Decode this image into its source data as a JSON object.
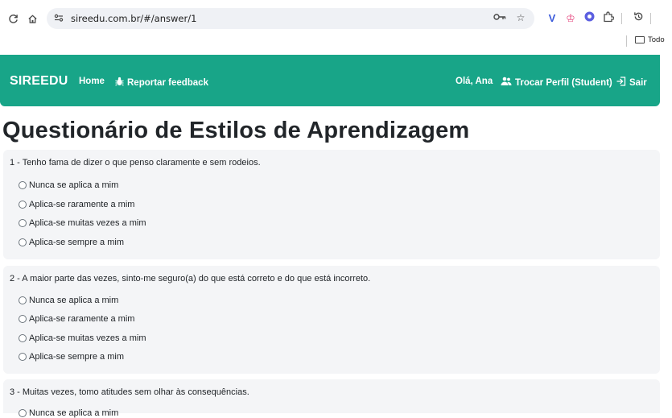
{
  "browser": {
    "url": "sireedu.com.br/#/answer/1",
    "bookmark_folder": "Todo"
  },
  "navbar": {
    "brand": "SIREEDU",
    "home": "Home",
    "feedback": "Reportar feedback",
    "greeting": "Olá, Ana",
    "switch_profile": "Trocar Perfil (Student)",
    "logout": "Sair",
    "color": "#18a588"
  },
  "page": {
    "title": "Questionário de Estilos de Aprendizagem"
  },
  "questions": [
    {
      "text": "1 - Tenho fama de dizer o que penso claramente e sem rodeios.",
      "options": [
        "Nunca se aplica a mim",
        "Aplica-se raramente a mim",
        "Aplica-se muitas vezes a mim",
        "Aplica-se sempre a mim"
      ]
    },
    {
      "text": "2 - A maior parte das vezes, sinto-me seguro(a) do que está correto e do que está incorreto.",
      "options": [
        "Nunca se aplica a mim",
        "Aplica-se raramente a mim",
        "Aplica-se muitas vezes a mim",
        "Aplica-se sempre a mim"
      ]
    },
    {
      "text": "3 - Muitas vezes, tomo atitudes sem olhar às consequências.",
      "options": [
        "Nunca se aplica a mim"
      ]
    }
  ]
}
